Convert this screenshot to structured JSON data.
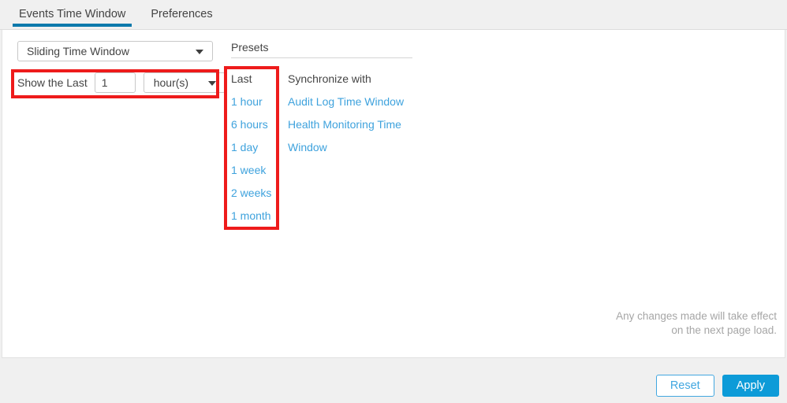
{
  "tabs": [
    {
      "label": "Events Time Window",
      "active": true
    },
    {
      "label": "Preferences",
      "active": false
    }
  ],
  "left_panel": {
    "window_mode": {
      "selected": "Sliding Time Window",
      "caret_icon": "chevron-down-icon"
    },
    "show_last": {
      "label": "Show the Last",
      "value": "1",
      "placeholder": "1",
      "unit_selected": "hour(s)",
      "unit_caret_icon": "chevron-down-icon"
    }
  },
  "presets": {
    "title": "Presets",
    "last_column": {
      "heading": "Last",
      "items": [
        "1 hour",
        "6 hours",
        "1 day",
        "1 week",
        "2 weeks",
        "1 month"
      ]
    },
    "sync_column": {
      "heading": "Synchronize with",
      "items": [
        "Audit Log Time Window",
        "Health Monitoring Time Window"
      ]
    }
  },
  "note": {
    "line1": "Any changes made will take effect",
    "line2": "on the next page load."
  },
  "footer": {
    "reset_label": "Reset",
    "apply_label": "Apply"
  },
  "colors": {
    "tab_active_underline": "#0b79ab",
    "link_blue": "#3ea2dd",
    "apply_button": "#0d9bd8",
    "reset_border": "#42a7e0",
    "annotation_red": "#ee1b1b",
    "header_background": "#f0f0f0",
    "note_text": "#a6a6a6"
  }
}
